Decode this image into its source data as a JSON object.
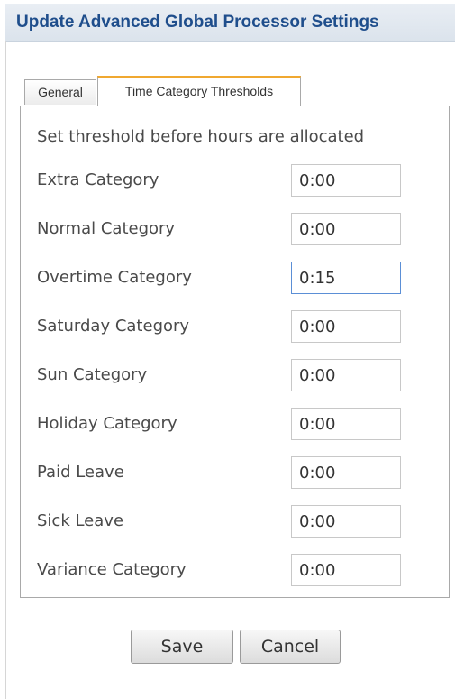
{
  "dialog": {
    "title": "Update Advanced Global Processor Settings"
  },
  "tabs": [
    {
      "label": "General",
      "active": false
    },
    {
      "label": "Time Category Thresholds",
      "active": true
    }
  ],
  "panel": {
    "instruction": "Set threshold before hours are allocated",
    "rows": [
      {
        "label": "Extra Category",
        "value": "0:00"
      },
      {
        "label": "Normal Category",
        "value": "0:00"
      },
      {
        "label": "Overtime Category",
        "value": "0:15",
        "focused": true
      },
      {
        "label": "Saturday Category",
        "value": "0:00"
      },
      {
        "label": "Sun Category",
        "value": "0:00"
      },
      {
        "label": "Holiday Category",
        "value": "0:00"
      },
      {
        "label": "Paid Leave",
        "value": "0:00"
      },
      {
        "label": "Sick Leave",
        "value": "0:00"
      },
      {
        "label": "Variance Category",
        "value": "0:00"
      }
    ]
  },
  "buttons": {
    "save_label": "Save",
    "cancel_label": "Cancel"
  },
  "colors": {
    "title_text": "#1f4e8c",
    "active_tab_accent": "#f0a830",
    "focused_input_border": "#5b8fd6"
  }
}
